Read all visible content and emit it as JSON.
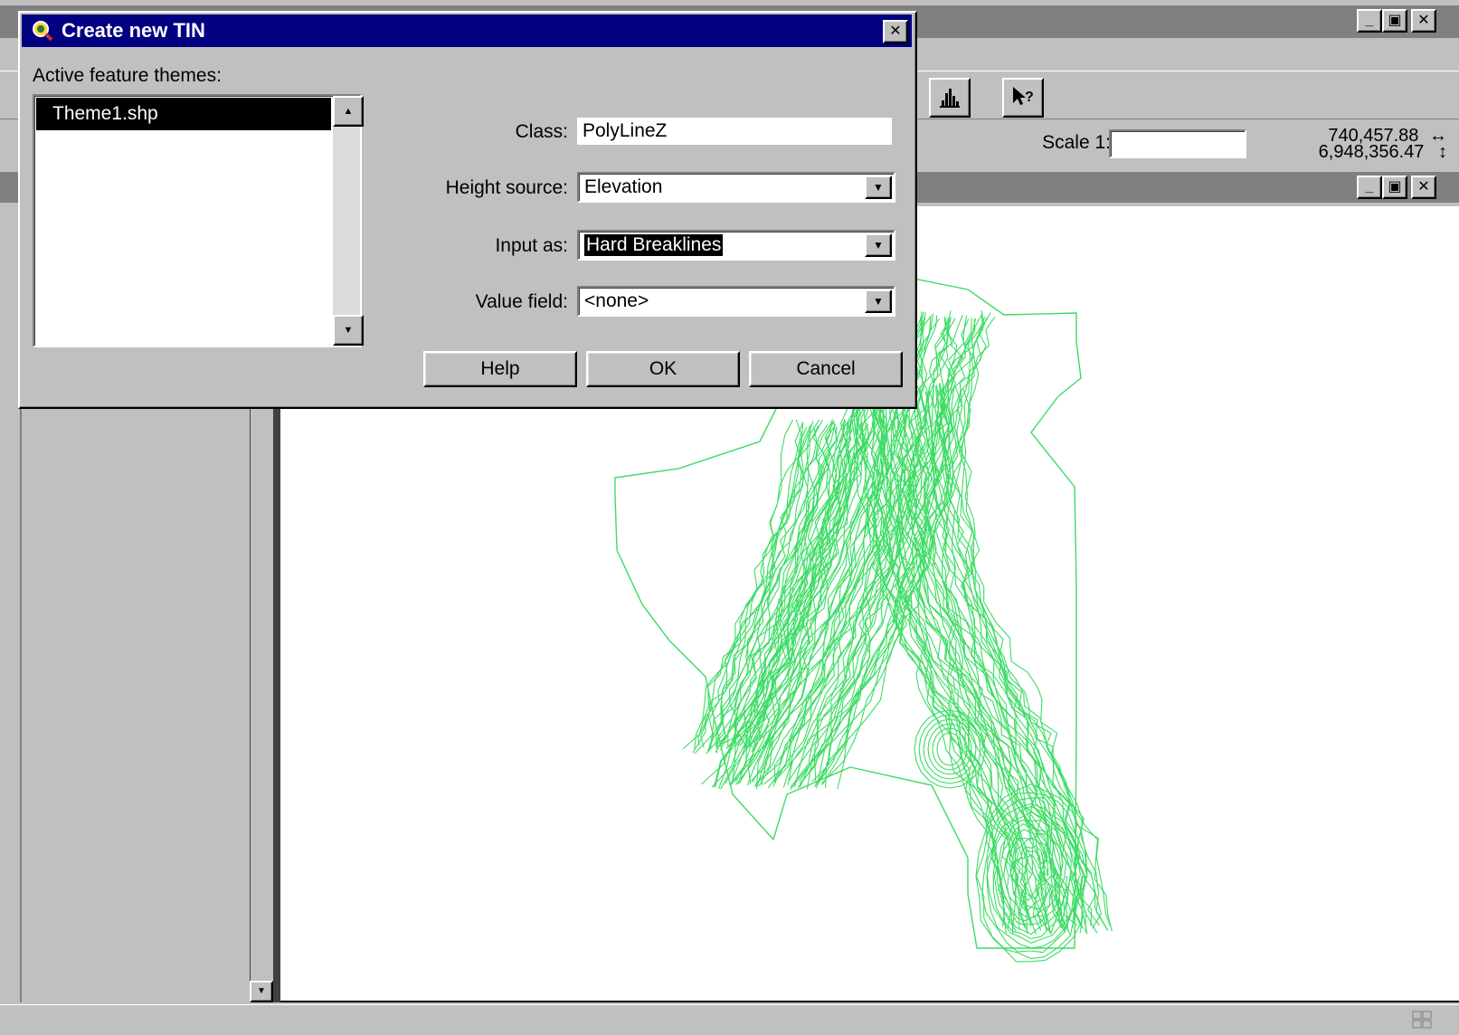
{
  "app_window": {
    "title_buttons": {
      "minimize": "_",
      "maximize": "▣",
      "close": "✕"
    }
  },
  "toolbar": {
    "histogram_icon": "histogram-icon",
    "help_pointer_icon": "help-pointer-icon",
    "scale_label": "Scale 1:",
    "scale_value": "",
    "coord_x": "740,457.88",
    "coord_y": "6,948,356.47",
    "coord_x_arrow": "↔",
    "coord_y_arrow": "↕"
  },
  "dialog": {
    "title": "Create new TIN",
    "close": "✕",
    "themes_label": "Active feature themes:",
    "themes": [
      "Theme1.shp"
    ],
    "selected_theme": 0,
    "class_label": "Class:",
    "class_value": "PolyLineZ",
    "height_source_label": "Height source:",
    "height_source_value": "Elevation",
    "input_as_label": "Input as:",
    "input_as_value": "Hard Breaklines",
    "value_field_label": "Value field:",
    "value_field_value": "<none>",
    "help_button": "Help",
    "ok_button": "OK",
    "cancel_button": "Cancel"
  },
  "map": {
    "line_color": "#3ddc64",
    "background": "#ffffff"
  }
}
